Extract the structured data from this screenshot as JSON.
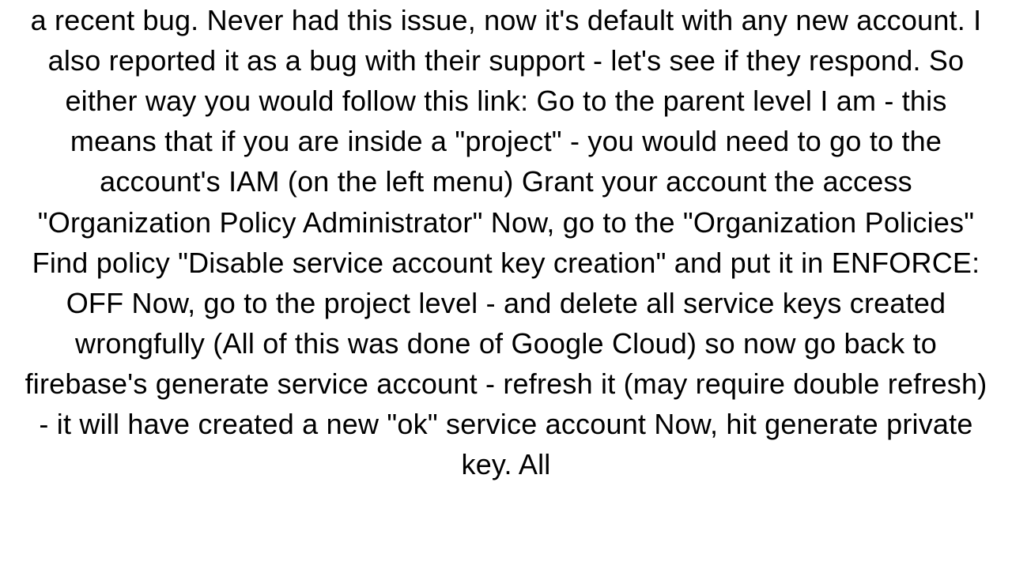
{
  "body": {
    "text": "a recent bug. Never had this issue, now it's default with any new account. I also reported it as a bug with their support - let's see if they respond. So either way you would follow this link:   Go to the parent level I am - this means that if you are inside a \"project\" - you would need to go to the account's IAM (on the left menu)   Grant your account the access \"Organization Policy Administrator\"  Now, go to the \"Organization Policies\"  Find policy \"Disable service account key creation\" and put it in ENFORCE: OFF  Now, go to the project level - and delete all service keys created wrongfully  (All of this was done of Google Cloud) so now go back to firebase's generate service account - refresh it (may require double refresh) - it will have created a new \"ok\" service account  Now, hit generate private key.  All"
  }
}
